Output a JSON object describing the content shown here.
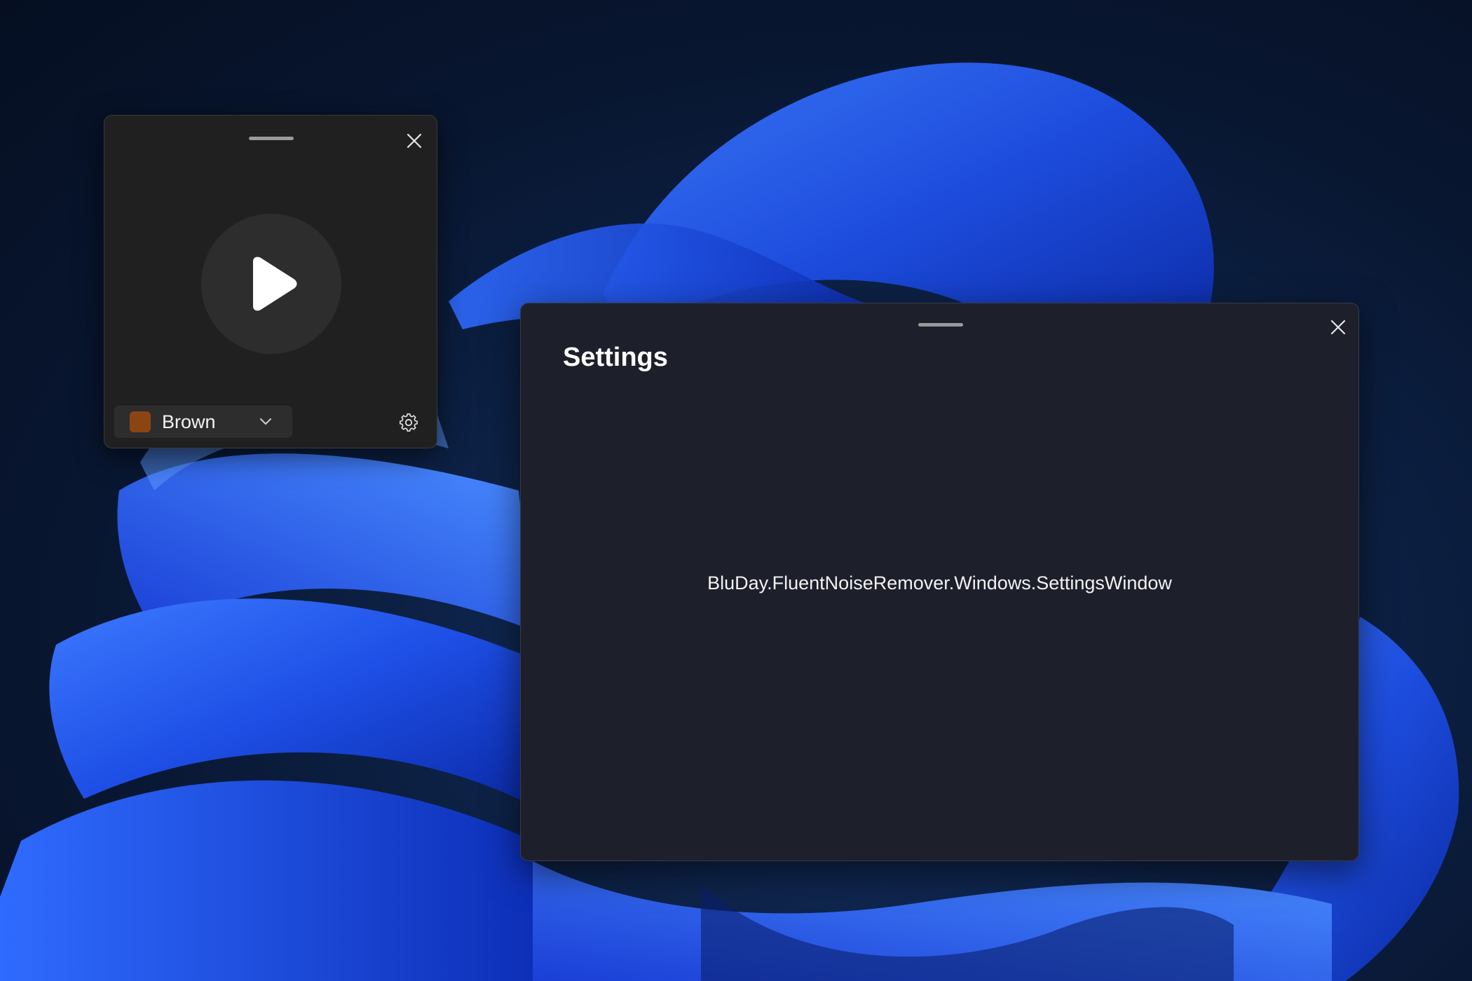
{
  "player": {
    "close_icon": "close-icon",
    "play_icon": "play-icon",
    "noise_type": {
      "selected": "Brown",
      "swatch_color": "#8b4513",
      "icon": "chevron-down-icon"
    },
    "settings_icon": "gear-icon"
  },
  "settings": {
    "title": "Settings",
    "close_icon": "close-icon",
    "placeholder_text": "BluDay.FluentNoiseRemover.Windows.SettingsWindow"
  },
  "colors": {
    "player_bg": "#202020",
    "settings_bg": "#1d1f2b",
    "wallpaper_accent": "#1e5bff"
  }
}
